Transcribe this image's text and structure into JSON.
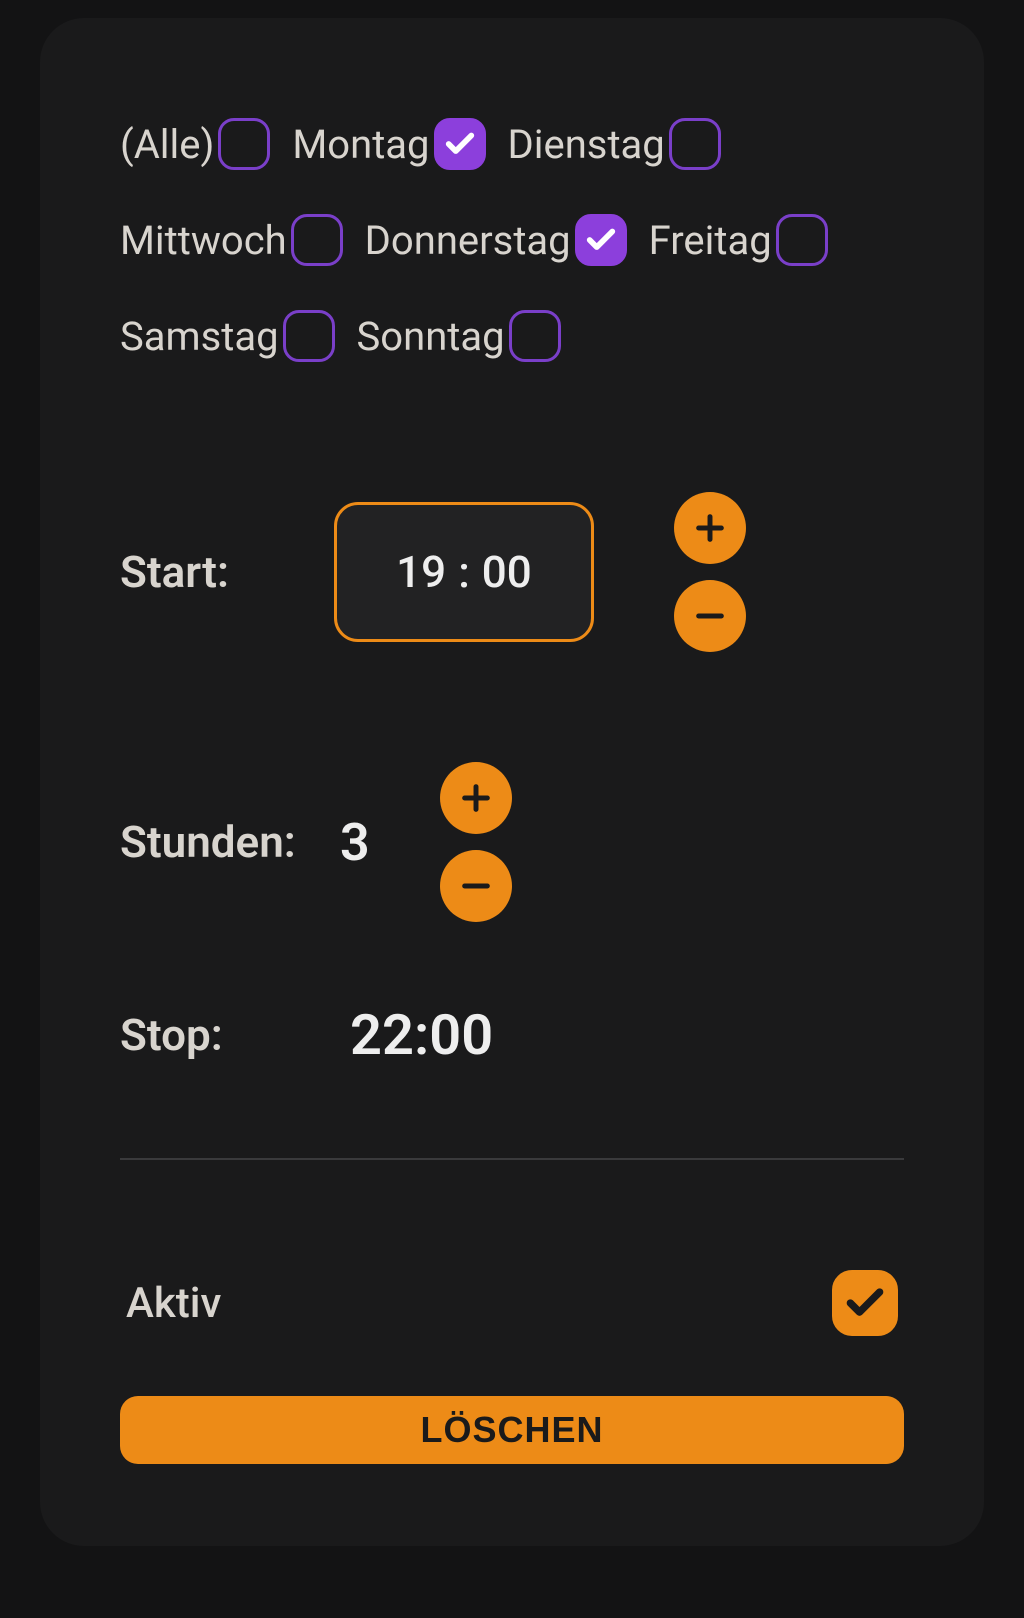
{
  "days": [
    {
      "label": "(Alle)",
      "checked": false,
      "name": "day-all"
    },
    {
      "label": "Montag",
      "checked": true,
      "name": "day-monday"
    },
    {
      "label": "Dienstag",
      "checked": false,
      "name": "day-tuesday"
    },
    {
      "label": "Mittwoch",
      "checked": false,
      "name": "day-wednesday"
    },
    {
      "label": "Donnerstag",
      "checked": true,
      "name": "day-thursday"
    },
    {
      "label": "Freitag",
      "checked": false,
      "name": "day-friday"
    },
    {
      "label": "Samstag",
      "checked": false,
      "name": "day-saturday"
    },
    {
      "label": "Sonntag",
      "checked": false,
      "name": "day-sunday"
    }
  ],
  "start": {
    "label": "Start:",
    "hour": "19",
    "minute": "00"
  },
  "hours": {
    "label": "Stunden:",
    "value": "3"
  },
  "stop": {
    "label": "Stop:",
    "value": "22:00"
  },
  "active": {
    "label": "Aktiv",
    "checked": true
  },
  "delete_label": "LÖSCHEN",
  "colors": {
    "accent_orange": "#ed8b17",
    "accent_purple": "#8c3fdc",
    "bg": "#1a1a1b"
  }
}
